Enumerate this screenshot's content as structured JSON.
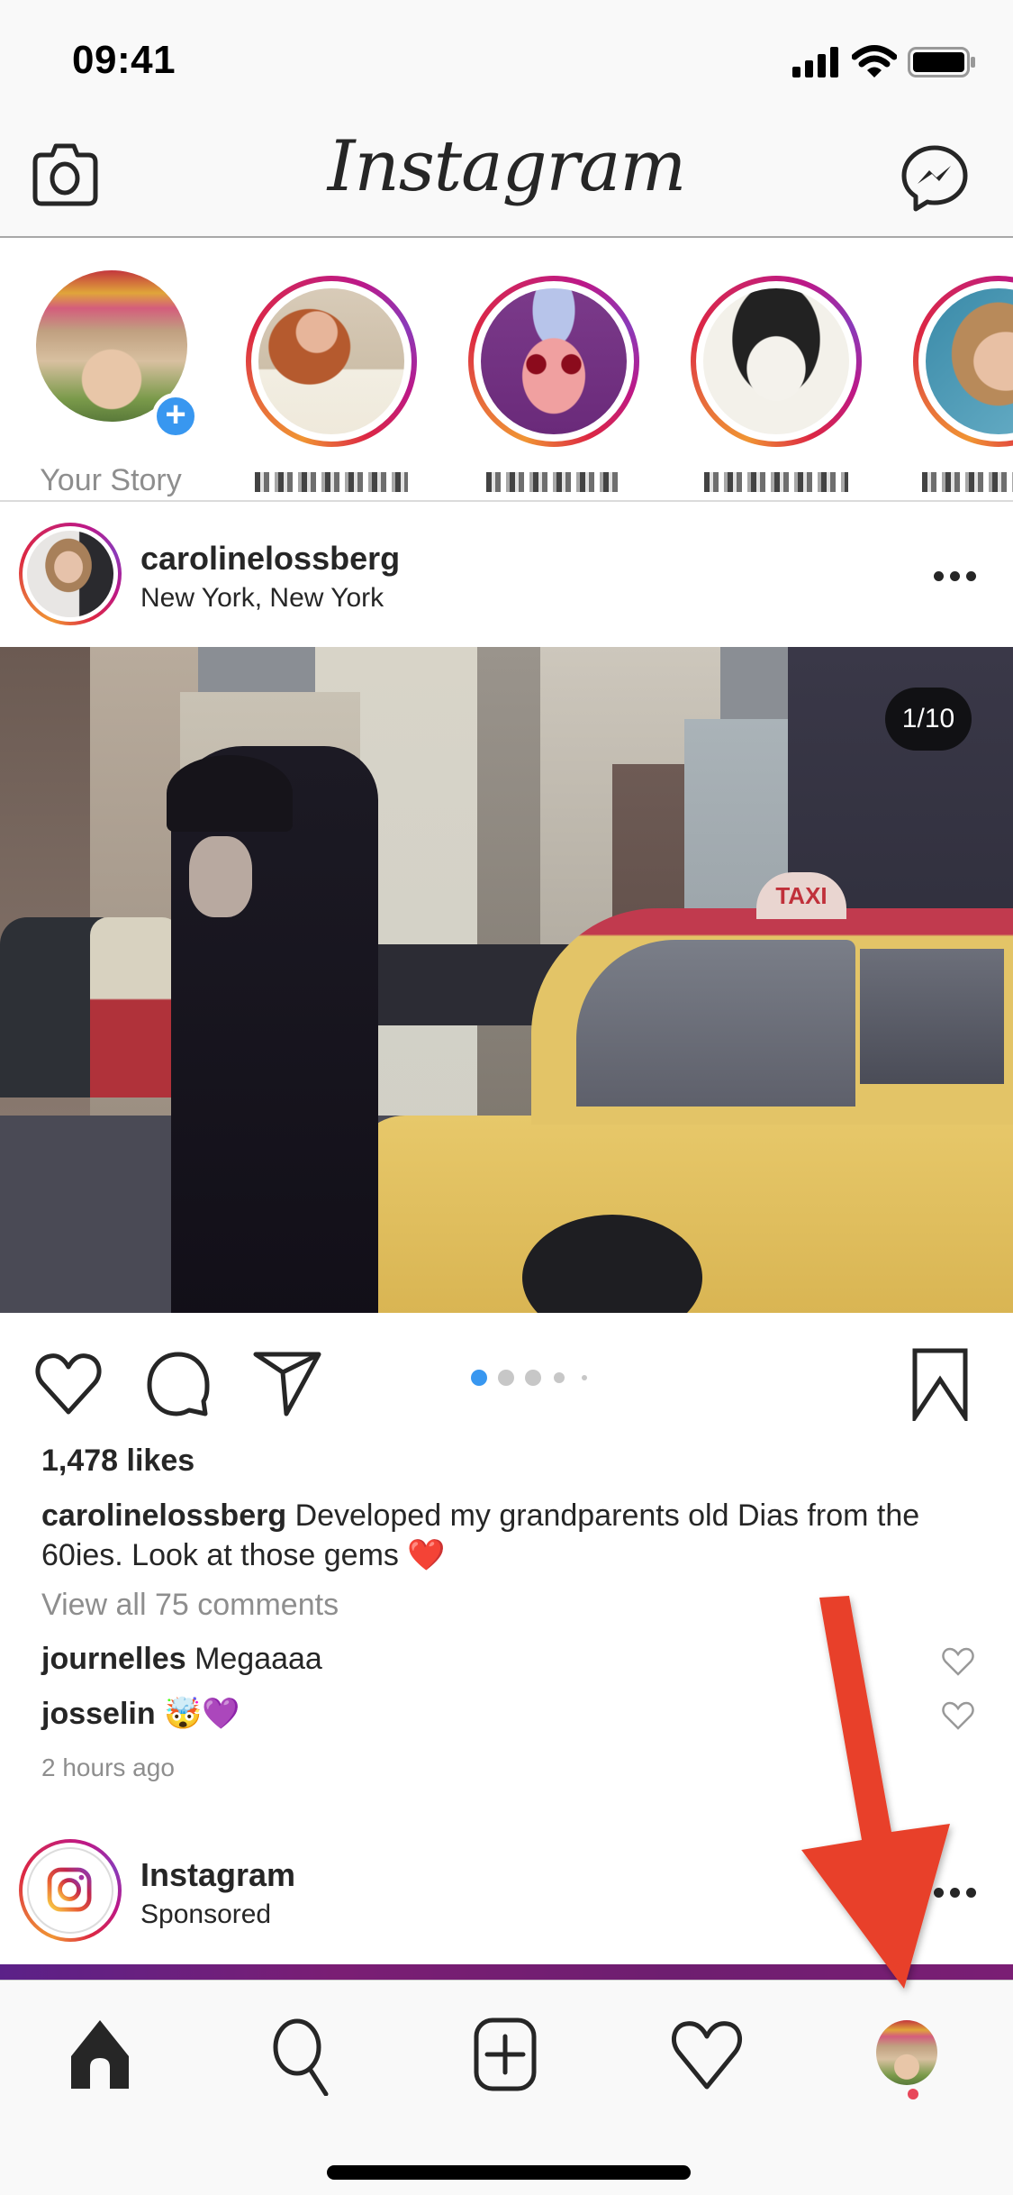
{
  "status_bar": {
    "time": "09:41"
  },
  "header": {
    "title": "Instagram",
    "camera_icon": "camera-icon",
    "messenger_icon": "messenger-icon"
  },
  "stories": [
    {
      "name": "Your Story",
      "type": "own",
      "badge": "+"
    },
    {
      "name": "[redacted]",
      "type": "unseen"
    },
    {
      "name": "[redacted]",
      "type": "unseen"
    },
    {
      "name": "[redacted]",
      "type": "unseen"
    },
    {
      "name": "[redacted]",
      "type": "unseen"
    }
  ],
  "post": {
    "username": "carolinelossberg",
    "location": "New York, New York",
    "carousel_counter": "1/10",
    "carousel_current": 1,
    "carousel_total": 10,
    "likes": "1,478 likes",
    "caption_user": "carolinelossberg",
    "caption_text": "Developed my grandparents old Dias from the 60ies. Look at those gems ❤️",
    "view_all_comments": "View all 75 comments",
    "comments": [
      {
        "user": "journelles",
        "text": "Megaaaa"
      },
      {
        "user": "josselin",
        "text": "🤯💜"
      }
    ],
    "time_ago": "2 hours ago"
  },
  "ad": {
    "username": "Instagram",
    "sub": "Sponsored"
  },
  "tabbar": {
    "items": [
      "home",
      "search",
      "new-post",
      "activity",
      "profile"
    ],
    "active": "home",
    "profile_notification": true
  },
  "annotation": {
    "type": "arrow",
    "color": "#e8412a",
    "points_to": "profile tab"
  },
  "colors": {
    "accent_blue": "#3897f0",
    "text": "#262626",
    "secondary": "#8e8e8e",
    "notification": "#e8475a"
  }
}
